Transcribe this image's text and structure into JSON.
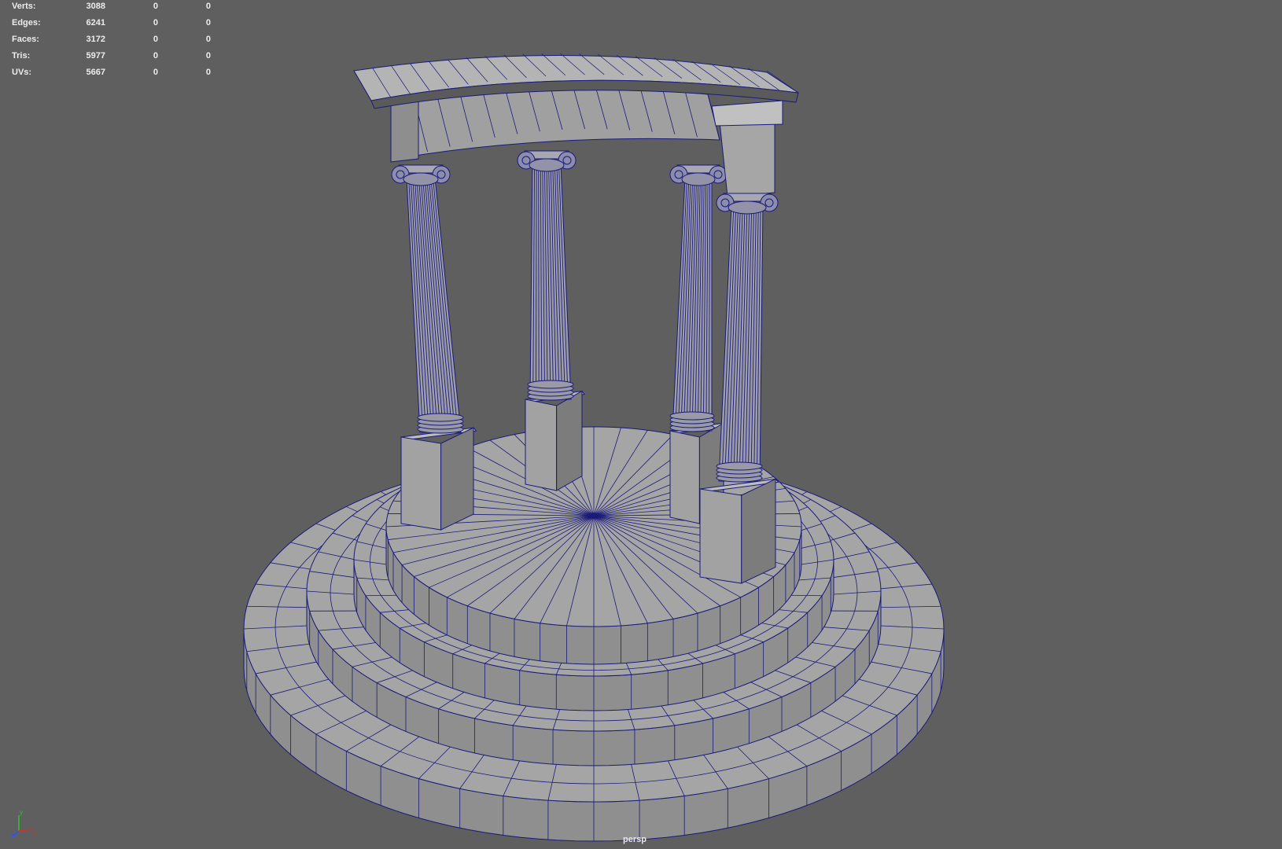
{
  "hud": {
    "rows": [
      {
        "label": "Verts:",
        "v1": "3088",
        "v2": "0",
        "v3": "0"
      },
      {
        "label": "Edges:",
        "v1": "6241",
        "v2": "0",
        "v3": "0"
      },
      {
        "label": "Faces:",
        "v1": "3172",
        "v2": "0",
        "v3": "0"
      },
      {
        "label": "Tris:",
        "v1": "5977",
        "v2": "0",
        "v3": "0"
      },
      {
        "label": "UVs:",
        "v1": "5667",
        "v2": "0",
        "v3": "0"
      }
    ]
  },
  "viewport": {
    "camera_label": "persp",
    "background_color": "#5f5f5f",
    "mesh_face_color": "#a5a5a5",
    "wireframe_color": "#1a1a7a"
  },
  "axis_gizmo": {
    "x_label": "x",
    "y_label": "y",
    "z_label": "z",
    "x_color": "#d03030",
    "y_color": "#30c030",
    "z_color": "#3050ff"
  }
}
